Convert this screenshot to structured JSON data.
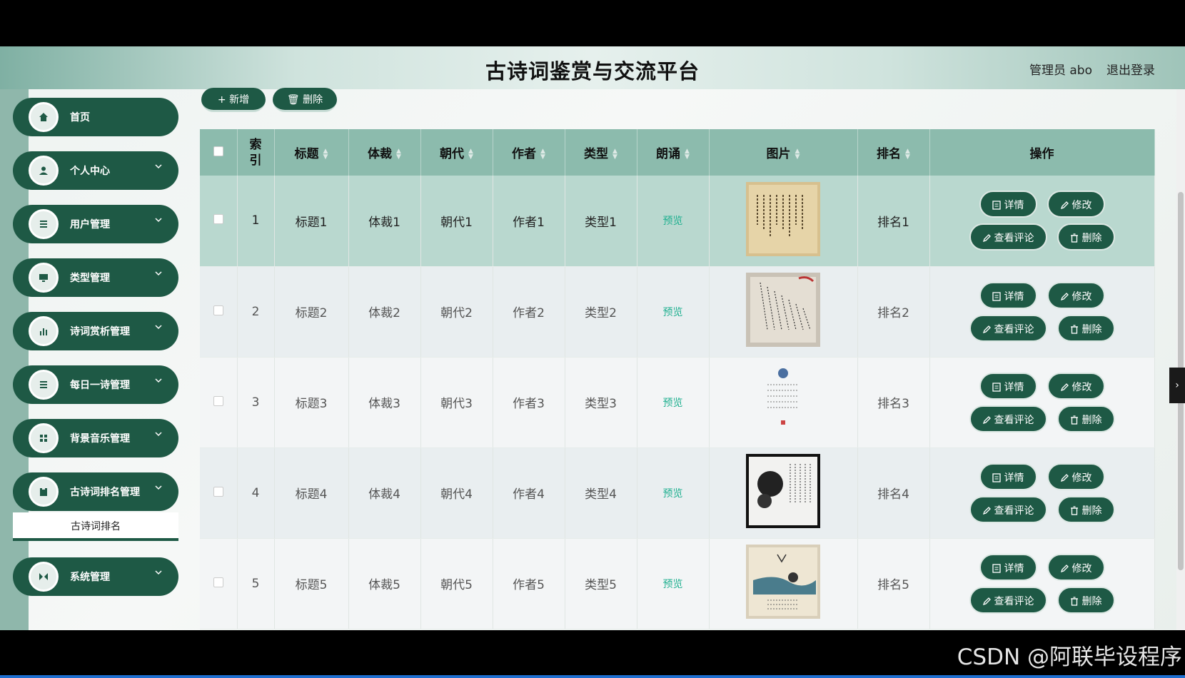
{
  "header": {
    "title": "古诗词鉴赏与交流平台",
    "user": "管理员 abo",
    "logout": "退出登录"
  },
  "sidebar": {
    "items": [
      {
        "label": "首页",
        "icon": "home-icon",
        "has_arrow": false
      },
      {
        "label": "个人中心",
        "icon": "user-icon",
        "has_arrow": true
      },
      {
        "label": "用户管理",
        "icon": "list-icon",
        "has_arrow": true
      },
      {
        "label": "类型管理",
        "icon": "monitor-icon",
        "has_arrow": true
      },
      {
        "label": "诗词赏析管理",
        "icon": "bar-chart-icon",
        "has_arrow": true
      },
      {
        "label": "每日一诗管理",
        "icon": "list-icon",
        "has_arrow": true
      },
      {
        "label": "背景音乐管理",
        "icon": "grid-icon",
        "has_arrow": true
      },
      {
        "label": "古诗词排名管理",
        "icon": "clipboard-icon",
        "has_arrow": true
      },
      {
        "label": "系统管理",
        "icon": "settings-icon",
        "has_arrow": true
      }
    ],
    "submenu": "古诗词排名"
  },
  "toolbar": {
    "add": "+ 新增",
    "delete": "删除"
  },
  "table": {
    "headers": [
      "索引",
      "标题",
      "体裁",
      "朝代",
      "作者",
      "类型",
      "朗诵",
      "图片",
      "排名",
      "操作"
    ],
    "rows": [
      {
        "index": "1",
        "title": "标题1",
        "genre": "体裁1",
        "dynasty": "朝代1",
        "author": "作者1",
        "type": "类型1",
        "recite": "预览",
        "rank": "排名1"
      },
      {
        "index": "2",
        "title": "标题2",
        "genre": "体裁2",
        "dynasty": "朝代2",
        "author": "作者2",
        "type": "类型2",
        "recite": "预览",
        "rank": "排名2"
      },
      {
        "index": "3",
        "title": "标题3",
        "genre": "体裁3",
        "dynasty": "朝代3",
        "author": "作者3",
        "type": "类型3",
        "recite": "预览",
        "rank": "排名3"
      },
      {
        "index": "4",
        "title": "标题4",
        "genre": "体裁4",
        "dynasty": "朝代4",
        "author": "作者4",
        "type": "类型4",
        "recite": "预览",
        "rank": "排名4"
      },
      {
        "index": "5",
        "title": "标题5",
        "genre": "体裁5",
        "dynasty": "朝代5",
        "author": "作者5",
        "type": "类型5",
        "recite": "预览",
        "rank": "排名5"
      }
    ],
    "ops": {
      "detail": "详情",
      "edit": "修改",
      "comments": "查看评论",
      "delete": "删除"
    }
  },
  "watermark": "CSDN @阿联毕设程序",
  "colors": {
    "primary": "#1e5945",
    "header_row": "#8cbbad",
    "preview": "#20b090"
  }
}
